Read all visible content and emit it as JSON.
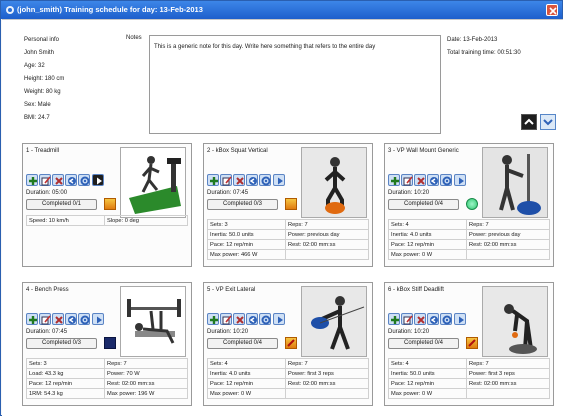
{
  "window": {
    "title": "(john_smith) Training schedule for day: 13-Feb-2013"
  },
  "personal": {
    "heading": "Personal info",
    "name": "John Smith",
    "age": "Age: 32",
    "height": "Height: 180 cm",
    "weight": "Weight: 80 kg",
    "sex": "Sex: Male",
    "bmi": "BMI: 24.7"
  },
  "notes": {
    "label": "Notes",
    "text": "This is a generic note for this day. Write here something that refers to the entire day"
  },
  "day": {
    "date": "Date: 13-Feb-2013",
    "total_time": "Total training time: 00:51:30"
  },
  "exercises": [
    {
      "name": "1 - Treadmill",
      "duration": "Duration: 05:00",
      "completed": "Completed 0/1",
      "status_color": "#f0a020",
      "details": [
        [
          "Speed: 10 km/h",
          "Slope: 0 deg"
        ]
      ]
    },
    {
      "name": "2 - kBox Squat Vertical",
      "duration": "Duration: 07:45",
      "completed": "Completed 0/3",
      "status_color": "#f0a020",
      "details": [
        [
          "Sets: 3",
          "Reps: 7"
        ],
        [
          "Inertia: 50.0 units",
          "Power: previous day"
        ],
        [
          "Pace: 12 rep/min",
          "Rest: 02:00 mm:ss"
        ],
        [
          "Max power: 466 W",
          ""
        ]
      ]
    },
    {
      "name": "3 - VP Wall Mount Generic",
      "duration": "Duration: 10:20",
      "completed": "Completed 0/4",
      "status_color": "#44dd88",
      "details": [
        [
          "Sets: 4",
          "Reps: 7"
        ],
        [
          "Inertia: 4.0 units",
          "Power: previous day"
        ],
        [
          "Pace: 12 rep/min",
          "Rest: 02:00 mm:ss"
        ],
        [
          "Max power: 0 W",
          ""
        ]
      ]
    },
    {
      "name": "4 - Bench Press",
      "duration": "Duration: 07:45",
      "completed": "Completed 0/3",
      "status_color": "#1a2a6a",
      "details": [
        [
          "Sets: 3",
          "Reps: 7"
        ],
        [
          "Load: 43.3 kg",
          "Power: 70 W"
        ],
        [
          "Pace: 12 rep/min",
          "Rest: 02:00 mm:ss"
        ],
        [
          "1RM: 54.3 kg",
          "Max power: 196 W"
        ]
      ]
    },
    {
      "name": "5 - VP Exit Lateral",
      "duration": "Duration: 10:20",
      "completed": "Completed 0/4",
      "status_color": "#f0a020",
      "details": [
        [
          "Sets: 4",
          "Reps: 7"
        ],
        [
          "Inertia: 4.0 units",
          "Power: first 3 reps"
        ],
        [
          "Pace: 12 rep/min",
          "Rest: 02:00 mm:ss"
        ],
        [
          "Max power: 0 W",
          ""
        ]
      ]
    },
    {
      "name": "6 - kBox Stiff Deadlift",
      "duration": "Duration: 10:20",
      "completed": "Completed 0/4",
      "status_color": "#f0a020",
      "details": [
        [
          "Sets: 4",
          "Reps: 7"
        ],
        [
          "Inertia: 50.0 units",
          "Power: first 3 reps"
        ],
        [
          "Pace: 12 rep/min",
          "Rest: 02:00 mm:ss"
        ],
        [
          "Max power: 0 W",
          ""
        ]
      ]
    }
  ],
  "icons": {
    "app": "app-icon",
    "close": "close-icon",
    "nav_up": "arrow-up-icon",
    "nav_down": "arrow-down-icon",
    "card_buttons": [
      "add-icon",
      "edit-icon",
      "tools-icon",
      "previous-icon",
      "settings-icon",
      "play-icon"
    ]
  },
  "colors": {
    "titlebar": "#1d5fcc",
    "button_blue": "#cfe0f5",
    "warning": "#f0a020",
    "ok": "#44dd88"
  }
}
